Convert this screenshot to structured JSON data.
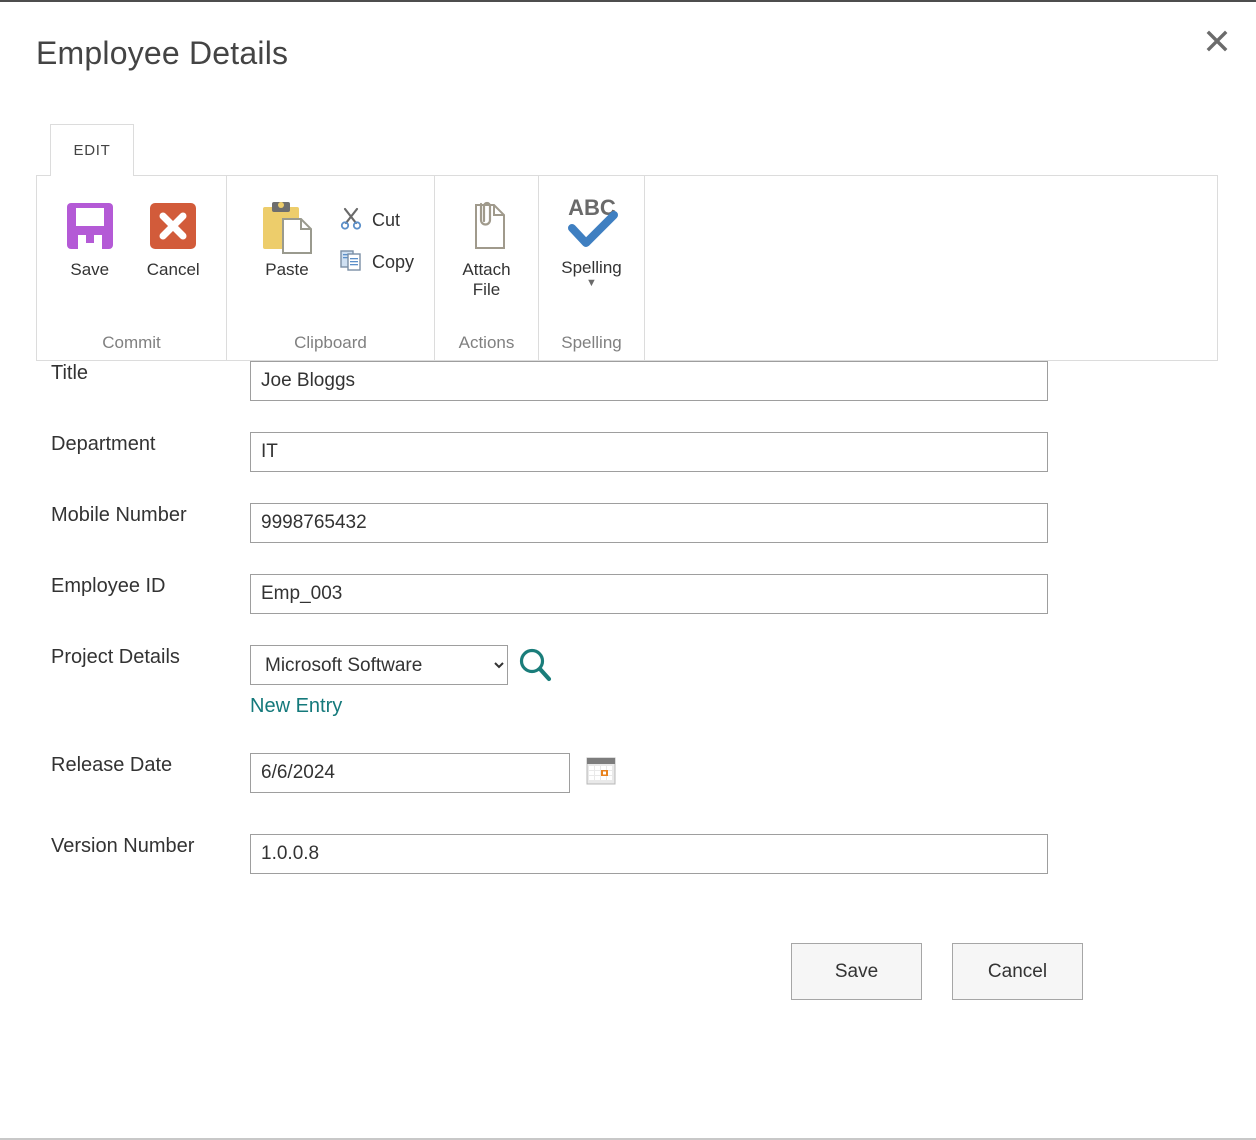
{
  "dialog": {
    "title": "Employee Details",
    "close_icon": "close-icon"
  },
  "ribbon": {
    "tabs": [
      {
        "label": "EDIT",
        "active": true
      }
    ],
    "groups": [
      {
        "name": "Commit",
        "label": "Commit",
        "items": [
          {
            "label": "Save",
            "icon": "floppy-disk-icon"
          },
          {
            "label": "Cancel",
            "icon": "cancel-x-icon"
          }
        ]
      },
      {
        "name": "Clipboard",
        "label": "Clipboard",
        "items": [
          {
            "label": "Paste",
            "icon": "clipboard-icon"
          },
          {
            "label": "Cut",
            "icon": "scissors-icon"
          },
          {
            "label": "Copy",
            "icon": "copy-pages-icon"
          }
        ]
      },
      {
        "name": "Actions",
        "label": "Actions",
        "items": [
          {
            "label": "Attach File",
            "icon": "paperclip-document-icon"
          }
        ]
      },
      {
        "name": "Spelling",
        "label": "Spelling",
        "items": [
          {
            "label": "Spelling",
            "icon": "abc-check-icon",
            "has_dropdown": true
          }
        ]
      }
    ]
  },
  "form": {
    "fields": [
      {
        "label": "Title",
        "value": "Joe Bloggs",
        "placeholder": ""
      },
      {
        "label": "Department",
        "value": "IT",
        "placeholder": ""
      },
      {
        "label": "Mobile Number",
        "value": "9998765432",
        "placeholder": ""
      },
      {
        "label": "Employee ID",
        "value": "Emp_003",
        "placeholder": ""
      },
      {
        "label": "Project Details",
        "value": "Microsoft Software",
        "placeholder": ""
      },
      {
        "label": "Release Date",
        "value": "6/6/2024",
        "placeholder": ""
      },
      {
        "label": "Version Number",
        "value": "1.0.0.8",
        "placeholder": ""
      }
    ],
    "project_options": [
      "Microsoft Software"
    ],
    "new_entry_link": "New Entry",
    "browse_icon": "search-magnifier-icon",
    "calendar_icon": "calendar-icon"
  },
  "footer": {
    "save_label": "Save",
    "cancel_label": "Cancel"
  },
  "colors": {
    "save_icon": "#b45ad6",
    "cancel_icon": "#d25b3a",
    "clipboard": "#edcd6b",
    "spelling_check": "#3f7fc1",
    "link_teal": "#14797b",
    "calendar_accent": "#e8821e",
    "border": "#9e9e9e",
    "ribbon_border": "#dcdcdc"
  }
}
